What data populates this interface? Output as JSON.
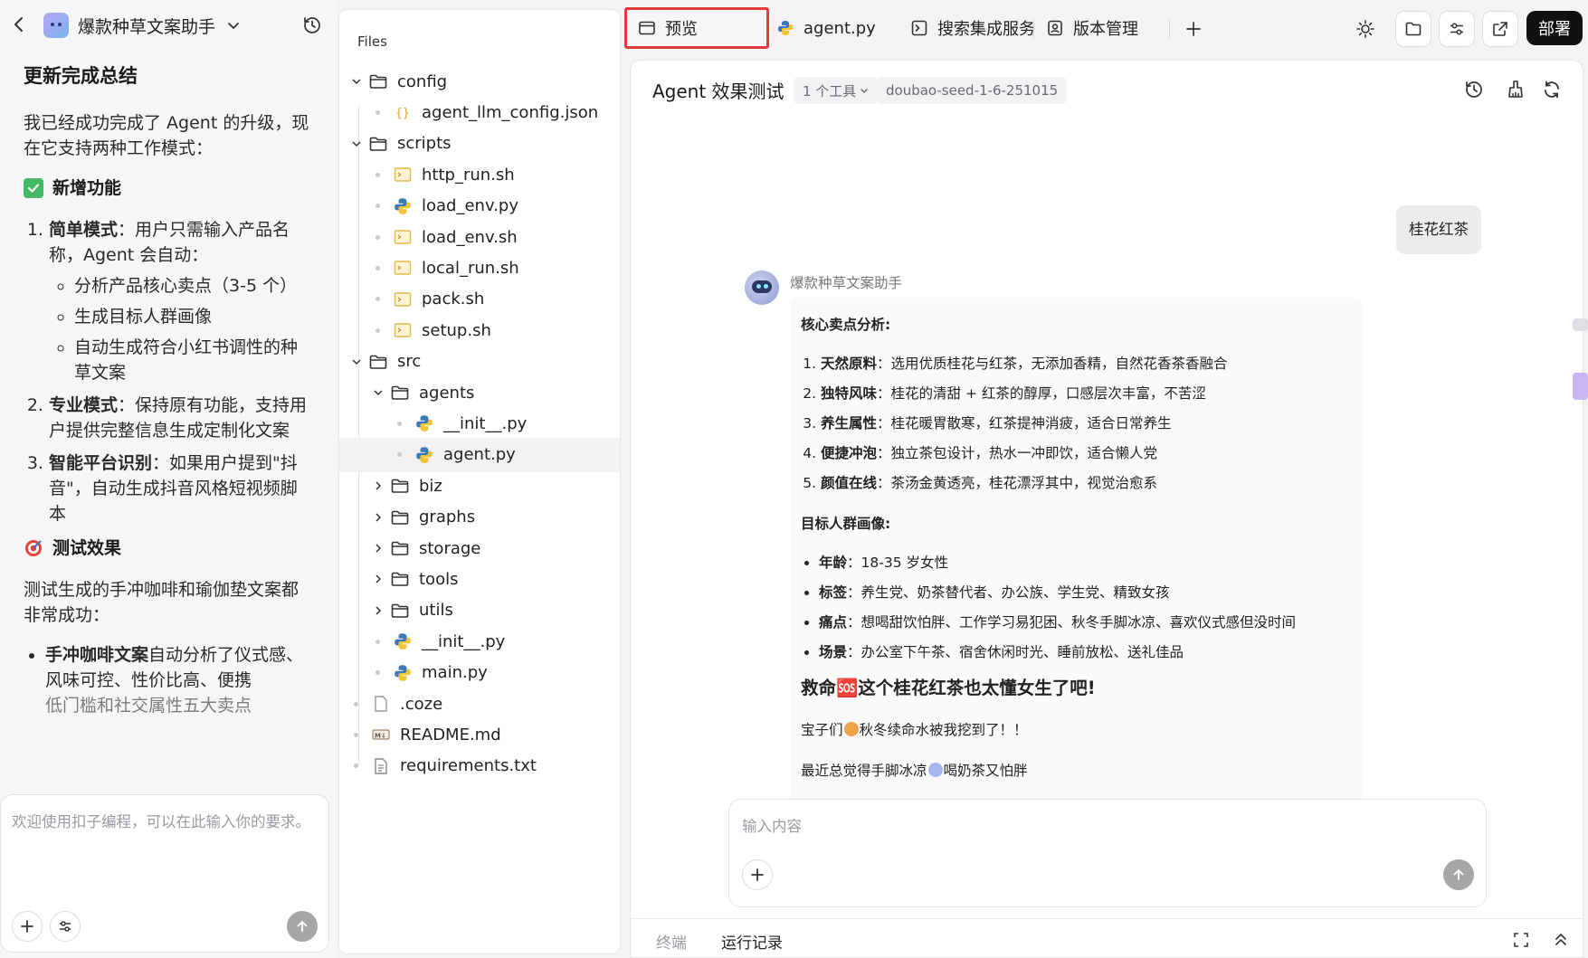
{
  "app": {
    "title": "爆款种草文案助手"
  },
  "chat": {
    "heading": "更新完成总结",
    "intro": "我已经成功完成了 Agent 的升级，现在它支持两种工作模式：",
    "section_new": "新增功能",
    "modes": [
      {
        "title": "简单模式",
        "desc": "：用户只需输入产品名称，Agent 会自动："
      },
      {
        "title": "专业模式",
        "desc": "：保持原有功能，支持用户提供完整信息生成定制化文案"
      },
      {
        "title": "智能平台识别",
        "desc": "：如果用户提到\"抖音\"，自动生成抖音风格短视频脚本"
      }
    ],
    "simple_steps": [
      "分析产品核心卖点（3-5 个）",
      "生成目标人群画像",
      "自动生成符合小红书调性的种草文案"
    ],
    "section_test": "测试效果",
    "test_intro": "测试生成的手冲咖啡和瑜伽垫文案都非常成功：",
    "test_item_title": "手冲咖啡文案",
    "test_item_desc": "自动分析了仪式感、风味可控、性价比高、便携",
    "test_item_cut": "低门槛和社交属性五大卖点",
    "input_placeholder": "欢迎使用扣子编程，可以在此输入你的要求。"
  },
  "files": {
    "header": "Files",
    "tree": [
      {
        "name": "config"
      },
      {
        "name": "agent_llm_config.json"
      },
      {
        "name": "scripts"
      },
      {
        "name": "http_run.sh"
      },
      {
        "name": "load_env.py"
      },
      {
        "name": "load_env.sh"
      },
      {
        "name": "local_run.sh"
      },
      {
        "name": "pack.sh"
      },
      {
        "name": "setup.sh"
      },
      {
        "name": "src"
      },
      {
        "name": "agents"
      },
      {
        "name": "__init__.py"
      },
      {
        "name": "agent.py"
      },
      {
        "name": "biz"
      },
      {
        "name": "graphs"
      },
      {
        "name": "storage"
      },
      {
        "name": "tools"
      },
      {
        "name": "utils"
      },
      {
        "name": "__init__.py"
      },
      {
        "name": "main.py"
      },
      {
        "name": ".coze"
      },
      {
        "name": "README.md"
      },
      {
        "name": "requirements.txt"
      }
    ]
  },
  "tabs": {
    "preview": "预览",
    "agent": "agent.py",
    "search": "搜索集成服务",
    "version": "版本管理",
    "deploy": "部署"
  },
  "preview": {
    "title": "Agent 效果测试",
    "tools_pill": "1 个工具",
    "model_pill": "doubao-seed-1-6-251015",
    "user_msg": "桂花红茶",
    "bot_name": "爆款种草文案助手",
    "selling_heading": "核心卖点分析:",
    "selling_points": [
      {
        "t": "天然原料",
        "d": "：选用优质桂花与红茶，无添加香精，自然花香茶香融合"
      },
      {
        "t": "独特风味",
        "d": "：桂花的清甜 + 红茶的醇厚，口感层次丰富，不苦涩"
      },
      {
        "t": "养生属性",
        "d": "：桂花暖胃散寒，红茶提神消疲，适合日常养生"
      },
      {
        "t": "便捷冲泡",
        "d": "：独立茶包设计，热水一冲即饮，适合懒人党"
      },
      {
        "t": "颜值在线",
        "d": "：茶汤金黄透亮，桂花漂浮其中，视觉治愈系"
      }
    ],
    "audience_heading": "目标人群画像:",
    "audience": [
      {
        "t": "年龄",
        "d": "：18-35 岁女性"
      },
      {
        "t": "标签",
        "d": "：养生党、奶茶替代者、办公族、学生党、精致女孩"
      },
      {
        "t": "痛点",
        "d": "：想喝甜饮怕胖、工作学习易犯困、秋冬手脚冰凉、喜欢仪式感但没时间"
      },
      {
        "t": "场景",
        "d": "：办公室下午茶、宿舍休闲时光、睡前放松、送礼佳品"
      }
    ],
    "post_title": "救命🆘这个桂花红茶也太懂女生了吧!",
    "para1a": "宝子们",
    "para1b": "秋冬续命水被我挖到了！！",
    "para2a": "最近总觉得手脚冰凉",
    "para2b": "喝奶茶又怕胖",
    "input_placeholder": "输入内容",
    "bottom_terminal": "终端",
    "bottom_logs": "运行记录"
  },
  "colors": {
    "accent_red": "#e13b3b",
    "check_green": "#42b965",
    "deploy_bg": "#111111"
  }
}
